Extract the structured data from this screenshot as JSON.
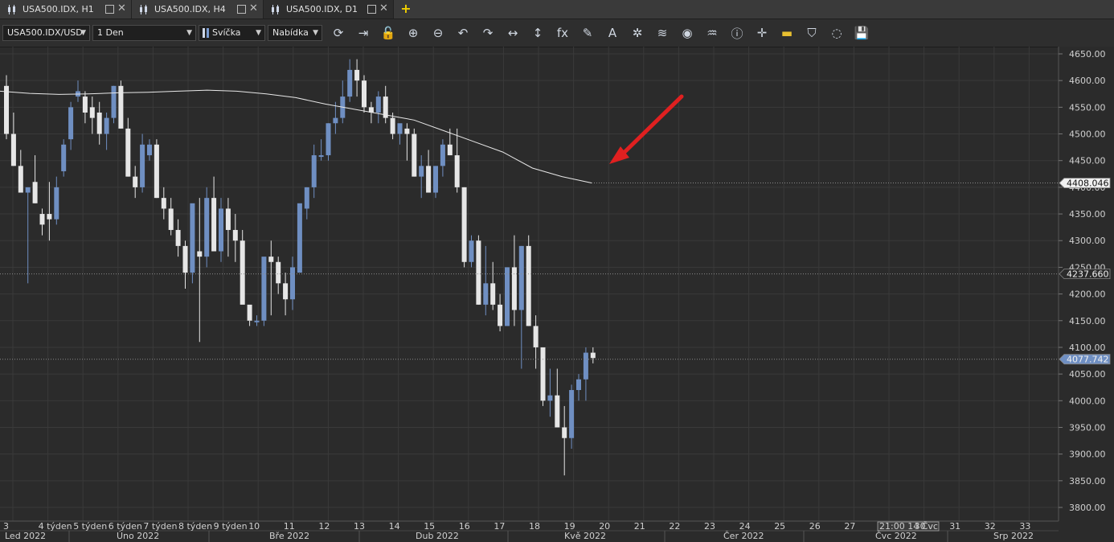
{
  "tabs": [
    {
      "label": "USA500.IDX, H1",
      "active": false
    },
    {
      "label": "USA500.IDX, H4",
      "active": false
    },
    {
      "label": "USA500.IDX, D1",
      "active": true
    }
  ],
  "toolbar": {
    "symbol": "USA500.IDX/USD",
    "timeframe": "1 Den",
    "chart_style": "Svíčka",
    "price_side": "Nabídka",
    "icons": [
      "refresh-icon",
      "autoscroll-icon",
      "unlock-icon",
      "zoom-in-icon",
      "zoom-out-icon",
      "undo-icon",
      "redo-icon",
      "horizontal-scale-icon",
      "vertical-scale-icon",
      "indicator-fx-icon",
      "pencil-icon",
      "text-annotation-icon",
      "crosshair-icon",
      "layers-icon",
      "eye-icon",
      "heatmap-icon",
      "info-icon",
      "cross-cursor-icon",
      "color-bar-icon",
      "paint-bucket-icon",
      "loading-ring-icon",
      "save-icon"
    ]
  },
  "colors": {
    "bull": "#6f8fc2",
    "bear": "#e6e6e6",
    "ma": "#e8e8e8",
    "arrow": "#e02020",
    "background": "#2b2b2b",
    "grid": "#3a3a3a"
  },
  "chart_data": {
    "type": "candlestick",
    "symbol": "USA500.IDX",
    "timeframe": "D1",
    "y_axis": {
      "min": 3800,
      "max": 4650,
      "ticks": [
        "4650.00",
        "4600.00",
        "4550.00",
        "4500.00",
        "4450.00",
        "4400.00",
        "4350.00",
        "4300.00",
        "4250.00",
        "4200.00",
        "4150.00",
        "4100.00",
        "4050.00",
        "4000.00",
        "3950.00",
        "3900.00",
        "3850.00",
        "3800.00"
      ]
    },
    "price_labels": [
      {
        "value": 4408.046,
        "text": "4408.046",
        "kind": "ma"
      },
      {
        "value": 4237.66,
        "text": "4237.660",
        "kind": "level"
      },
      {
        "value": 4077.742,
        "text": "4077.742",
        "kind": "last"
      }
    ],
    "week_labels": [
      "3",
      "4 týden",
      "5 týden",
      "6 týden",
      "7 týden",
      "8 týden",
      "9 týden",
      "10",
      "11",
      "12",
      "13",
      "14",
      "15",
      "16",
      "17",
      "18",
      "19",
      "20",
      "21",
      "22",
      "23",
      "24",
      "25",
      "26",
      "27",
      "21:00 14 Čvc",
      "30",
      "31",
      "32",
      "33"
    ],
    "month_labels": [
      "Led 2022",
      "Úno 2022",
      "Bře 2022",
      "Dub 2022",
      "Kvě 2022",
      "Čer 2022",
      "Čvc 2022",
      "Srp 2022"
    ],
    "candles": [
      [
        4590,
        4610,
        4490,
        4500
      ],
      [
        4500,
        4540,
        4440,
        4440
      ],
      [
        4440,
        4470,
        4390,
        4390
      ],
      [
        4390,
        4400,
        4220,
        4400
      ],
      [
        4410,
        4460,
        4370,
        4370
      ],
      [
        4350,
        4360,
        4310,
        4330
      ],
      [
        4350,
        4410,
        4300,
        4340
      ],
      [
        4340,
        4420,
        4330,
        4400
      ],
      [
        4430,
        4490,
        4420,
        4480
      ],
      [
        4490,
        4560,
        4470,
        4550
      ],
      [
        4570,
        4600,
        4560,
        4580
      ],
      [
        4570,
        4580,
        4520,
        4540
      ],
      [
        4550,
        4570,
        4500,
        4530
      ],
      [
        4540,
        4560,
        4480,
        4500
      ],
      [
        4500,
        4540,
        4470,
        4530
      ],
      [
        4530,
        4590,
        4520,
        4590
      ],
      [
        4590,
        4600,
        4510,
        4510
      ],
      [
        4510,
        4530,
        4420,
        4420
      ],
      [
        4420,
        4440,
        4380,
        4400
      ],
      [
        4400,
        4500,
        4390,
        4480
      ],
      [
        4460,
        4490,
        4450,
        4480
      ],
      [
        4480,
        4490,
        4380,
        4380
      ],
      [
        4380,
        4400,
        4340,
        4360
      ],
      [
        4360,
        4380,
        4310,
        4320
      ],
      [
        4320,
        4340,
        4270,
        4290
      ],
      [
        4290,
        4300,
        4210,
        4240
      ],
      [
        4240,
        4360,
        4220,
        4370
      ],
      [
        4280,
        4380,
        4110,
        4270
      ],
      [
        4270,
        4400,
        4250,
        4380
      ],
      [
        4380,
        4420,
        4280,
        4280
      ],
      [
        4280,
        4380,
        4260,
        4360
      ],
      [
        4360,
        4380,
        4270,
        4320
      ],
      [
        4320,
        4350,
        4260,
        4300
      ],
      [
        4300,
        4320,
        4190,
        4180
      ],
      [
        4180,
        4150,
        4140,
        4150
      ],
      [
        4150,
        4160,
        4140,
        4150
      ],
      [
        4150,
        4200,
        4140,
        4270
      ],
      [
        4270,
        4300,
        4160,
        4260
      ],
      [
        4260,
        4270,
        4200,
        4220
      ],
      [
        4220,
        4240,
        4160,
        4190
      ],
      [
        4190,
        4270,
        4170,
        4250
      ],
      [
        4240,
        4360,
        4240,
        4370
      ],
      [
        4360,
        4400,
        4340,
        4400
      ],
      [
        4400,
        4480,
        4380,
        4460
      ],
      [
        4460,
        4490,
        4450,
        4460
      ],
      [
        4460,
        4520,
        4450,
        4520
      ],
      [
        4520,
        4560,
        4500,
        4530
      ],
      [
        4530,
        4600,
        4520,
        4570
      ],
      [
        4570,
        4640,
        4560,
        4620
      ],
      [
        4620,
        4640,
        4570,
        4600
      ],
      [
        4600,
        4610,
        4540,
        4550
      ],
      [
        4550,
        4560,
        4520,
        4540
      ],
      [
        4540,
        4580,
        4520,
        4570
      ],
      [
        4570,
        4590,
        4520,
        4530
      ],
      [
        4530,
        4540,
        4490,
        4500
      ],
      [
        4500,
        4510,
        4480,
        4520
      ],
      [
        4510,
        4520,
        4450,
        4500
      ],
      [
        4500,
        4510,
        4420,
        4420
      ],
      [
        4420,
        4460,
        4380,
        4440
      ],
      [
        4440,
        4470,
        4390,
        4390
      ],
      [
        4390,
        4440,
        4380,
        4440
      ],
      [
        4440,
        4490,
        4420,
        4480
      ],
      [
        4480,
        4510,
        4460,
        4460
      ],
      [
        4460,
        4510,
        4390,
        4400
      ],
      [
        4400,
        4400,
        4250,
        4260
      ],
      [
        4260,
        4310,
        4250,
        4300
      ],
      [
        4300,
        4310,
        4180,
        4180
      ],
      [
        4180,
        4290,
        4160,
        4220
      ],
      [
        4220,
        4260,
        4170,
        4180
      ],
      [
        4180,
        4200,
        4130,
        4140
      ],
      [
        4140,
        4250,
        4140,
        4250
      ],
      [
        4250,
        4310,
        4140,
        4170
      ],
      [
        4170,
        4290,
        4060,
        4290
      ],
      [
        4290,
        4310,
        4140,
        4140
      ],
      [
        4140,
        4160,
        4060,
        4100
      ],
      [
        4100,
        4100,
        3990,
        4000
      ],
      [
        4000,
        4060,
        3970,
        4010
      ],
      [
        4010,
        4060,
        3950,
        3950
      ],
      [
        3950,
        3990,
        3860,
        3930
      ],
      [
        3930,
        4030,
        3910,
        4020
      ],
      [
        4020,
        4050,
        4000,
        4040
      ],
      [
        4040,
        4100,
        4000,
        4090
      ],
      [
        4090,
        4100,
        4070,
        4080
      ]
    ],
    "ma": [
      4580,
      4576,
      4574,
      4575,
      4577,
      4578,
      4580,
      4582,
      4580,
      4575,
      4568,
      4556,
      4546,
      4536,
      4526,
      4506,
      4486,
      4466,
      4436,
      4420,
      4408.046
    ]
  }
}
